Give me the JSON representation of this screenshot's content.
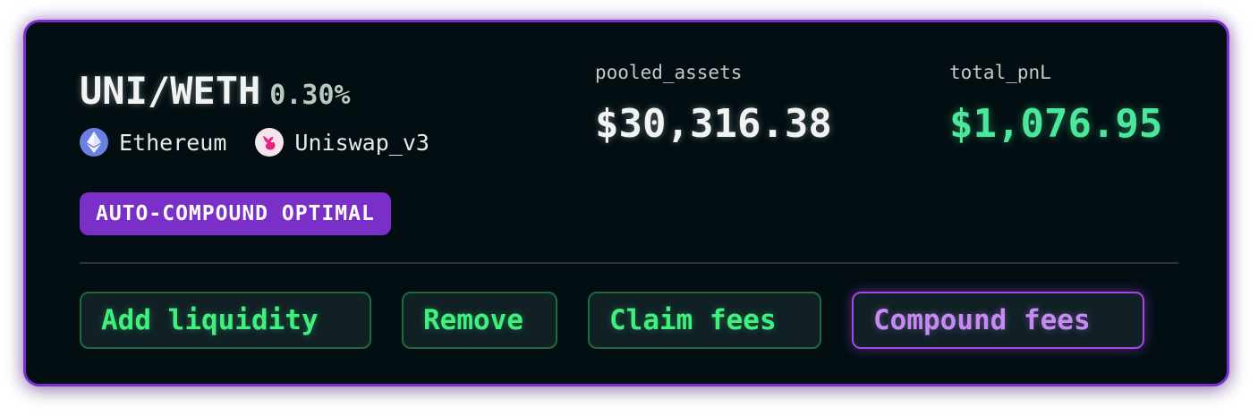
{
  "pool": {
    "pair": "UNI/WETH",
    "fee_tier": "0.30%",
    "network": {
      "label": "Ethereum",
      "icon": "ethereum-icon"
    },
    "protocol": {
      "label": "Uniswap_v3",
      "icon": "uniswap-icon"
    },
    "badge": "AUTO-COMPOUND OPTIMAL"
  },
  "stats": {
    "pooled_label": "pooled_assets",
    "pooled_value": "$30,316.38",
    "pnl_label": "total_pnL",
    "pnl_value": "$1,076.95"
  },
  "actions": {
    "add": "Add liquidity",
    "remove": "Remove",
    "claim": "Claim fees",
    "compound": "Compound fees"
  },
  "colors": {
    "accent_purple": "#7a2fc8",
    "positive_green": "#4be79b",
    "action_green": "#3ff07e",
    "background": "#020e12"
  }
}
